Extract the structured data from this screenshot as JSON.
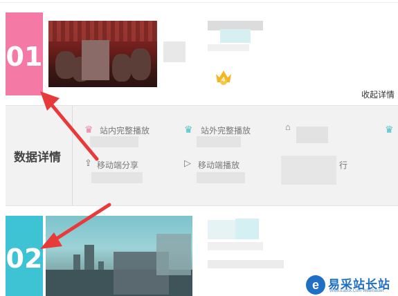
{
  "ranks": [
    {
      "number": "01",
      "color": "#f47aa5"
    },
    {
      "number": "02",
      "color": "#3ec3d4"
    }
  ],
  "item1": {
    "crown_level": "4",
    "crown_color": "#f2b722"
  },
  "collapse_link": "收起详情",
  "details": {
    "label": "数据详情",
    "stats": [
      {
        "label": "站内完整播放",
        "icon": "crown-pink-icon"
      },
      {
        "label": "站外完整播放",
        "icon": "crown-teal-icon"
      },
      {
        "label": "移动端分享",
        "icon": "share-icon"
      },
      {
        "label": "移动端播放",
        "icon": "play-icon"
      },
      {
        "label": "行",
        "icon": "none"
      }
    ]
  },
  "watermark": {
    "title": "易采站长站",
    "subtitle": "Www.Easck.Com Webmaster"
  },
  "colors": {
    "pink": "#f47aa5",
    "teal": "#3ec3d4",
    "arrow": "#e83a3a",
    "panel_bg": "#f2f2f2"
  }
}
